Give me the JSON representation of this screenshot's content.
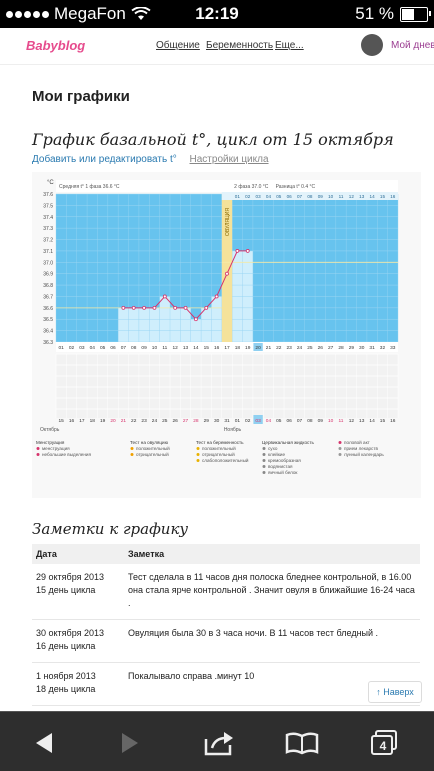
{
  "status": {
    "carrier": "MegaFon",
    "time": "12:19",
    "battery": "51 %",
    "battery_level": 0.51
  },
  "topnav": {
    "logo": "Babyblog",
    "items": [
      "Общение",
      "Беременность",
      "Еще..."
    ],
    "user_link": "Мой дневник"
  },
  "page_title": "Мои графики",
  "chart_title": "График базальной t°, цикл от 15 октября",
  "chart_links": {
    "edit": "Добавить или редактировать t°",
    "settings": "Настройки цикла"
  },
  "chart_data": {
    "type": "line",
    "ylabel": "°C",
    "y_ticks": [
      36.3,
      36.4,
      36.5,
      36.6,
      36.7,
      36.8,
      36.9,
      37.0,
      37.1,
      37.2,
      37.3,
      37.4,
      37.5,
      37.6
    ],
    "ylim": [
      36.3,
      37.6
    ],
    "info": {
      "phase1": "Средняя t° 1 фаза 36.6 °C",
      "phase2": "2 фаза 37.0 °C",
      "diff": "Разница t° 0.4 °C"
    },
    "ovulation_label": "ОВУЛЯЦИЯ",
    "cycle_days": [
      "01",
      "02",
      "03",
      "04",
      "05",
      "06",
      "07",
      "08",
      "09",
      "10",
      "11",
      "12",
      "13",
      "14",
      "15",
      "16",
      "17",
      "18",
      "19",
      "20",
      "21",
      "22",
      "23",
      "24",
      "25",
      "26",
      "27",
      "28",
      "29",
      "30",
      "31",
      "32",
      "33"
    ],
    "dates": [
      "15",
      "16",
      "17",
      "18",
      "19",
      "20",
      "21",
      "22",
      "23",
      "24",
      "25",
      "26",
      "27",
      "28",
      "29",
      "30",
      "31",
      "01",
      "02",
      "03",
      "04",
      "05",
      "06",
      "07",
      "08",
      "09",
      "10",
      "11",
      "12",
      "13",
      "14",
      "15",
      "16"
    ],
    "top_dates": [
      "01",
      "02",
      "03",
      "04",
      "05",
      "06",
      "07",
      "08",
      "09",
      "10",
      "11",
      "12",
      "13",
      "14",
      "15",
      "16"
    ],
    "temperatures": [
      null,
      null,
      null,
      null,
      null,
      null,
      36.6,
      36.6,
      36.6,
      36.6,
      36.7,
      36.6,
      36.6,
      36.5,
      36.6,
      36.7,
      36.9,
      37.1,
      37.1,
      null,
      null,
      null,
      null,
      null,
      null,
      null,
      null,
      null,
      null,
      null,
      null,
      null,
      null
    ],
    "ovulation_day": 17,
    "current_day": 20,
    "month_labels": [
      "Октябрь",
      "Ноябрь"
    ],
    "legend": {
      "menstruation": {
        "title": "Менструация",
        "items": [
          "менструация",
          "небольшие выделения"
        ]
      },
      "ovulation_test": {
        "title": "Тест на овуляцию",
        "items": [
          "положительный",
          "отрицательный"
        ]
      },
      "pregnancy_test": {
        "title": "Тест на беременность",
        "items": [
          "положительный",
          "отрицательный",
          "слабоположительный"
        ]
      },
      "mucus": {
        "title": "Цервикальная жидкость",
        "items": [
          "сухо",
          "клейкие",
          "кремообразная",
          "водянистая",
          "яичный белок"
        ]
      },
      "other": {
        "items": [
          "половой акт",
          "прием лекарств",
          "лунный календарь"
        ]
      }
    }
  },
  "notes_title": "Заметки к графику",
  "notes": {
    "headers": [
      "Дата",
      "Заметка"
    ],
    "rows": [
      {
        "date": "29 октября 2013",
        "day": "15 день цикла",
        "text": "Тест сделала в 11 часов дня полоска бледнее контрольной, в 16.00 она стала ярче контрольной . Значит овуля в ближайшие 16-24 часа ."
      },
      {
        "date": "30 октября 2013",
        "day": "16 день цикла",
        "text": "Овуляция была 30 в 3 часа ночи. В 11 часов тест бледный ."
      },
      {
        "date": "1 ноября 2013",
        "day": "18 день цикла",
        "text": "Покалывало справа .минут 10"
      }
    ]
  },
  "back_button": "↑ Наверх",
  "toolbar": {
    "tabs_count": "4"
  }
}
